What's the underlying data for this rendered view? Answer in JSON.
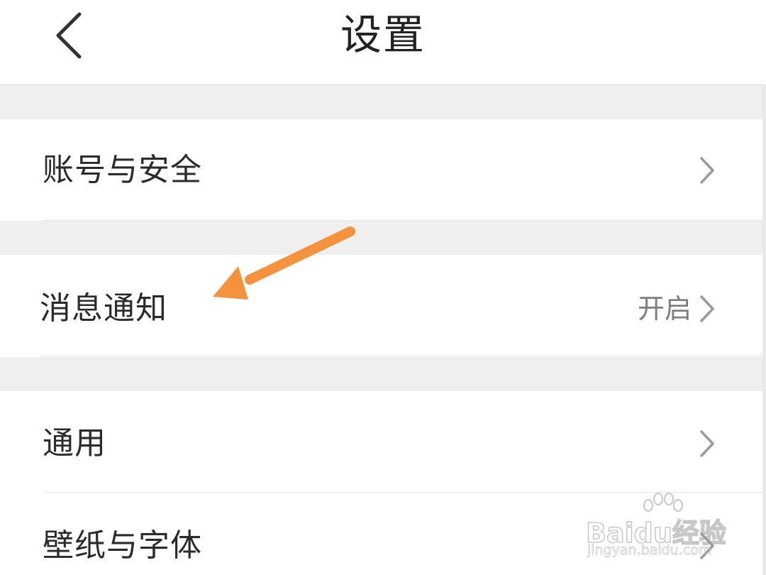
{
  "header": {
    "title": "设置",
    "back_icon": "chevron-left-icon"
  },
  "settings": {
    "account_security": {
      "label": "账号与安全",
      "icon": "chevron-right-icon"
    },
    "notifications": {
      "label": "消息通知",
      "value": "开启",
      "icon": "chevron-right-icon"
    },
    "general": {
      "label": "通用",
      "icon": "chevron-right-icon"
    },
    "wallpaper_font": {
      "label": "壁纸与字体",
      "icon": "chevron-right-icon"
    }
  },
  "annotation": {
    "arrow_color": "#f5923e"
  },
  "watermark": {
    "brand": "Baidu经验",
    "url": "jingyan.baidu.com"
  },
  "colors": {
    "separator_background": "#efefef",
    "primary_text": "#2b2b2b",
    "secondary_text": "#7d7d7d",
    "chevron": "#9a9a9a"
  }
}
